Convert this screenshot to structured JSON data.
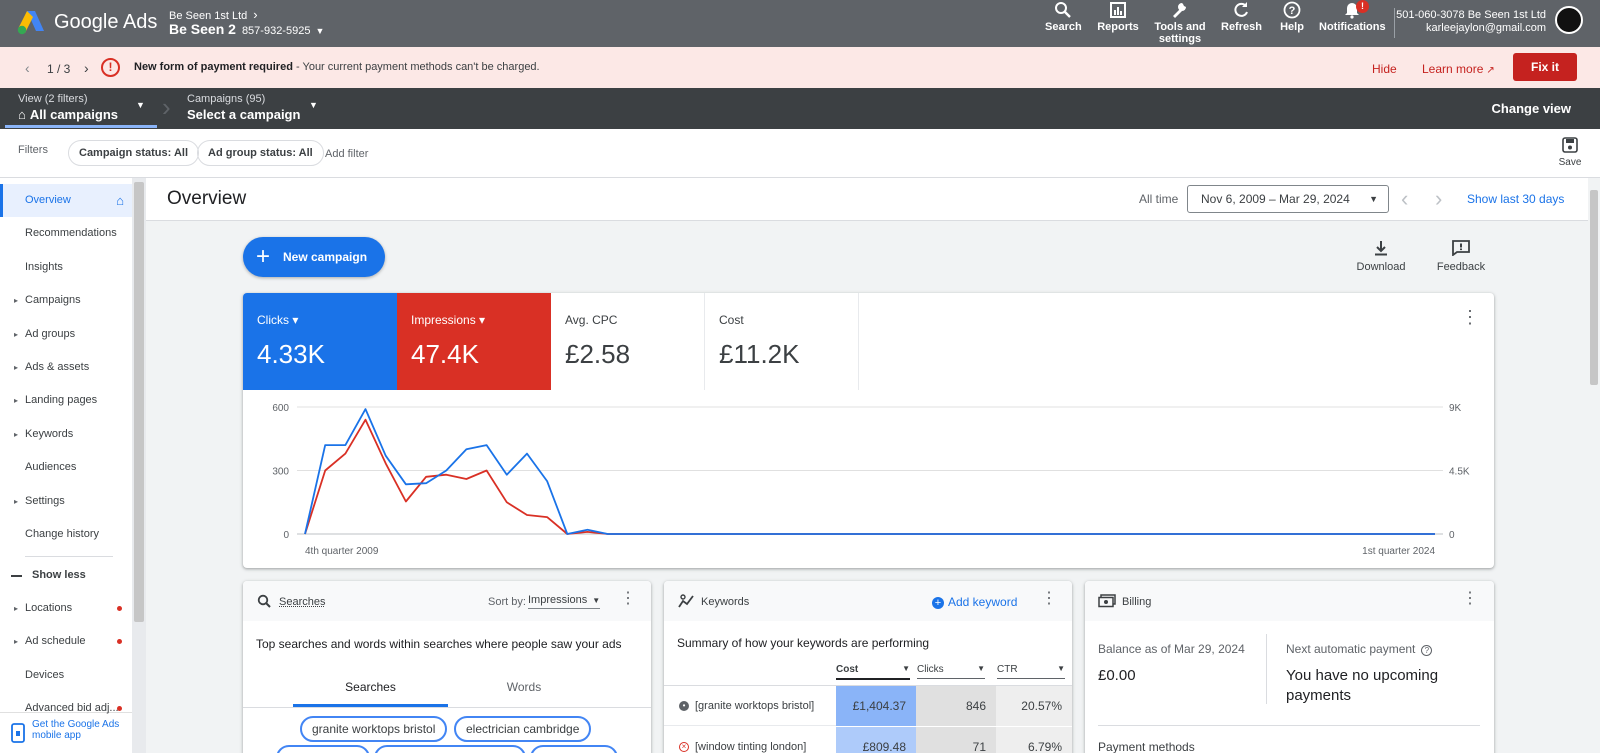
{
  "header": {
    "app_name": "Google Ads",
    "account_name": "Be Seen 1st Ltd",
    "sub_account": "Be Seen 2",
    "sub_account_id": "857-932-5925",
    "tools": [
      {
        "label": "Search",
        "icon": "search-icon"
      },
      {
        "label": "Reports",
        "icon": "reports-icon"
      },
      {
        "label": "Tools and settings",
        "icon": "wrench-icon"
      },
      {
        "label": "Refresh",
        "icon": "refresh-icon"
      },
      {
        "label": "Help",
        "icon": "help-icon"
      },
      {
        "label": "Notifications",
        "icon": "bell-icon"
      }
    ],
    "notification_badge": "!",
    "account_line": "501-060-3078 Be Seen 1st Ltd",
    "email": "karleejaylon@gmail.com"
  },
  "alert": {
    "counter": "1 / 3",
    "title": "New form of payment required",
    "message": " - Your current payment methods can't be charged.",
    "hide": "Hide",
    "learn_more": "Learn more",
    "fix": "Fix it"
  },
  "campaign_bar": {
    "view_label": "View (2 filters)",
    "view_value": "All campaigns",
    "campaigns_label": "Campaigns (95)",
    "campaigns_value": "Select a campaign",
    "change_view": "Change view"
  },
  "filters": {
    "label": "Filters",
    "chips": [
      "Campaign status: All",
      "Ad group status: All"
    ],
    "add_filter": "Add filter",
    "save": "Save"
  },
  "sidebar": {
    "items": [
      {
        "label": "Overview",
        "caret": false,
        "dot": false
      },
      {
        "label": "Recommendations",
        "caret": false,
        "dot": false
      },
      {
        "label": "Insights",
        "caret": false,
        "dot": false
      },
      {
        "label": "Campaigns",
        "caret": true,
        "dot": false
      },
      {
        "label": "Ad groups",
        "caret": true,
        "dot": false
      },
      {
        "label": "Ads & assets",
        "caret": true,
        "dot": false
      },
      {
        "label": "Landing pages",
        "caret": true,
        "dot": false
      },
      {
        "label": "Keywords",
        "caret": true,
        "dot": false
      },
      {
        "label": "Audiences",
        "caret": false,
        "dot": false
      },
      {
        "label": "Settings",
        "caret": true,
        "dot": false
      },
      {
        "label": "Change history",
        "caret": false,
        "dot": false
      }
    ],
    "show_less": "Show less",
    "more_items": [
      {
        "label": "Locations",
        "caret": true,
        "dot": true
      },
      {
        "label": "Ad schedule",
        "caret": true,
        "dot": true
      },
      {
        "label": "Devices",
        "caret": false,
        "dot": false
      },
      {
        "label": "Advanced bid adj...",
        "caret": false,
        "dot": true
      }
    ],
    "mobile_app": "Get the Google Ads mobile app"
  },
  "overview": {
    "title": "Overview",
    "date_label": "All time",
    "date_range": "Nov 6, 2009 – Mar 29, 2024",
    "show_last": "Show last 30 days",
    "new_campaign": "New campaign",
    "download": "Download",
    "feedback": "Feedback"
  },
  "metrics": [
    {
      "label": "Clicks",
      "value": "4.33K",
      "color": "#1a73e8",
      "dropdown": true
    },
    {
      "label": "Impressions",
      "value": "47.4K",
      "color": "#d93025",
      "dropdown": true
    },
    {
      "label": "Avg. CPC",
      "value": "£2.58",
      "color": "#ffffff",
      "dropdown": false
    },
    {
      "label": "Cost",
      "value": "£11.2K",
      "color": "#ffffff",
      "dropdown": false
    }
  ],
  "chart_data": {
    "type": "line",
    "x_start_label": "4th quarter 2009",
    "x_end_label": "1st quarter 2024",
    "left_ticks": [
      "600",
      "300",
      "0"
    ],
    "right_ticks": [
      "9K",
      "4.5K",
      "0"
    ],
    "ylim_left": [
      0,
      600
    ],
    "ylim_right": [
      0,
      9000
    ],
    "series": [
      {
        "name": "Clicks",
        "color": "#1a73e8",
        "axis": "left",
        "values": [
          0,
          420,
          420,
          590,
          370,
          235,
          240,
          300,
          400,
          420,
          280,
          380,
          250,
          0,
          20,
          0,
          0,
          0,
          0,
          0,
          0,
          0,
          0,
          0,
          0,
          0,
          0,
          0,
          0,
          0,
          0,
          0,
          0,
          0,
          0,
          0,
          0,
          0,
          0,
          0,
          0,
          0,
          0,
          0,
          0,
          0,
          0,
          0,
          0,
          0,
          0,
          0,
          0,
          0,
          0,
          0,
          0
        ]
      },
      {
        "name": "Impressions",
        "color": "#d93025",
        "axis": "right",
        "values": [
          0,
          4500,
          5700,
          8100,
          5000,
          2300,
          4050,
          4200,
          3900,
          4500,
          2250,
          1350,
          1200,
          0,
          150,
          0,
          0,
          0,
          0,
          0,
          0,
          0,
          0,
          0,
          0,
          0,
          0,
          0,
          0,
          0,
          0,
          0,
          0,
          0,
          0,
          0,
          0,
          0,
          0,
          0,
          0,
          0,
          0,
          0,
          0,
          0,
          0,
          0,
          0,
          0,
          0,
          0,
          0,
          0,
          0,
          0,
          0
        ]
      }
    ]
  },
  "searches_card": {
    "title": "Searches",
    "sort_label": "Sort by:",
    "sort_value": "Impressions",
    "description": "Top searches and words within searches where people saw your ads",
    "tab_searches": "Searches",
    "tab_words": "Words",
    "chips": [
      "granite worktops bristol",
      "electrician cambridge"
    ]
  },
  "keywords_card": {
    "title": "Keywords",
    "add_keyword": "Add keyword",
    "summary": "Summary of how your keywords are performing",
    "columns": [
      "Cost",
      "Clicks",
      "CTR"
    ],
    "rows": [
      {
        "keyword": "[granite worktops bristol]",
        "cost": "£1,404.37",
        "clicks": "846",
        "ctr": "20.57%"
      },
      {
        "keyword": "[window tinting london]",
        "cost": "£809.48",
        "clicks": "71",
        "ctr": "6.79%"
      }
    ]
  },
  "billing_card": {
    "title": "Billing",
    "balance_label": "Balance as of Mar 29, 2024",
    "balance_value": "£0.00",
    "next_label": "Next automatic payment",
    "next_value": "You have no upcoming payments",
    "payment_methods": "Payment methods"
  }
}
